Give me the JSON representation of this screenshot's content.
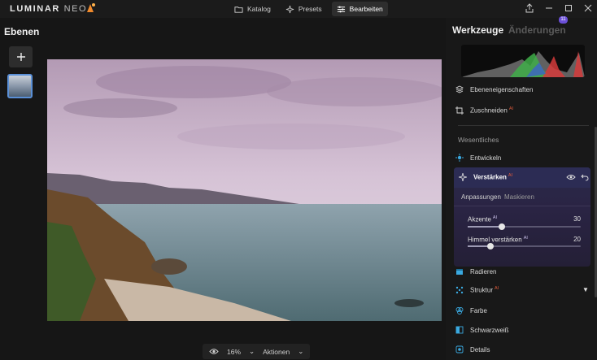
{
  "app": {
    "logo": "LUMINAR",
    "logo_suffix": "NEO"
  },
  "topbar": {
    "tabs": [
      {
        "label": "Katalog",
        "icon": "folder-icon"
      },
      {
        "label": "Presets",
        "icon": "sparkle-icon"
      },
      {
        "label": "Bearbeiten",
        "icon": "sliders-icon",
        "active": true
      }
    ]
  },
  "left_panel": {
    "title": "Ebenen"
  },
  "right_panel": {
    "title_active": "Werkzeuge",
    "title_inactive": "Änderungen",
    "changes_badge": "11",
    "rows": {
      "layer_props": "Ebeneneigenschaften",
      "crop": "Zuschneiden",
      "section_essentials": "Wesentliches",
      "develop": "Entwickeln",
      "enhance": "Verstärken",
      "erase": "Radieren",
      "structure": "Struktur",
      "color": "Farbe",
      "bw": "Schwarzweiß",
      "details": "Details"
    },
    "enhance_panel": {
      "subtab_adjust": "Anpassungen",
      "subtab_mask": "Maskieren",
      "sliders": [
        {
          "label": "Akzente",
          "value": "30",
          "fraction": 0.3
        },
        {
          "label": "Himmel verstärken",
          "value": "20",
          "fraction": 0.2
        }
      ]
    }
  },
  "bottom_toolbar": {
    "zoom": "16%",
    "actions": "Aktionen"
  },
  "colors": {
    "accent": "#5a8fd6",
    "ai_badge": "#e05b3b",
    "enhance_bg": "#2c2c54"
  }
}
